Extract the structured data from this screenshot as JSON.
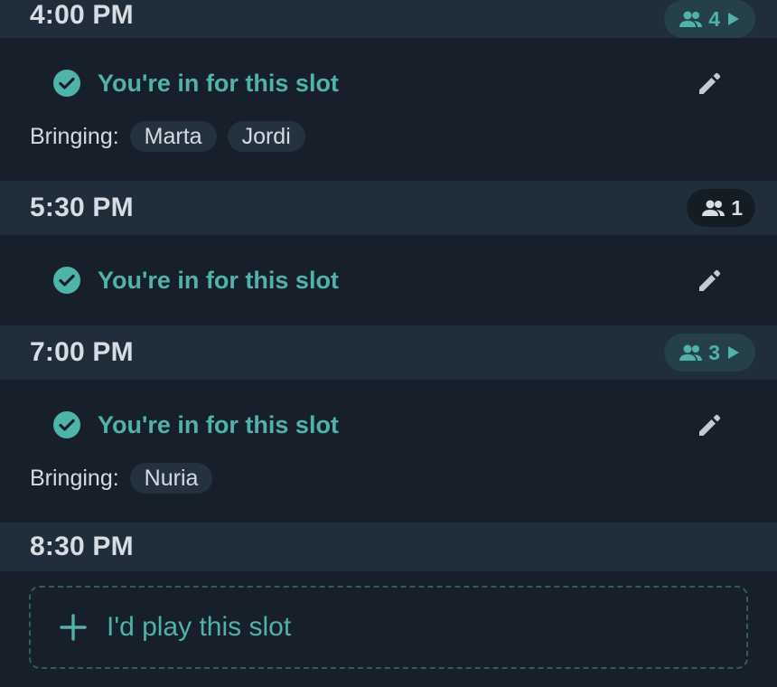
{
  "colors": {
    "accent": "#4fb3aa",
    "header_bg": "#202e3b",
    "body_bg": "#17202a",
    "chip_bg": "#243240"
  },
  "slots": [
    {
      "time": "4:00 PM",
      "count": "4",
      "expandable": true,
      "status": "You're in for this slot",
      "bringing_label": "Bringing:",
      "bringing": [
        "Marta",
        "Jordi"
      ]
    },
    {
      "time": "5:30 PM",
      "count": "1",
      "expandable": false,
      "status": "You're in for this slot",
      "bringing_label": "",
      "bringing": []
    },
    {
      "time": "7:00 PM",
      "count": "3",
      "expandable": true,
      "status": "You're in for this slot",
      "bringing_label": "Bringing:",
      "bringing": [
        "Nuria"
      ]
    },
    {
      "time": "8:30 PM",
      "count": "",
      "expandable": false,
      "status": "",
      "bringing_label": "",
      "bringing": []
    }
  ],
  "add_slot": {
    "label": "I'd play this slot",
    "icon": "plus-icon"
  },
  "icons": {
    "people": "people-icon",
    "play": "play-arrow-icon",
    "check": "check-circle-icon",
    "edit": "pencil-icon"
  }
}
